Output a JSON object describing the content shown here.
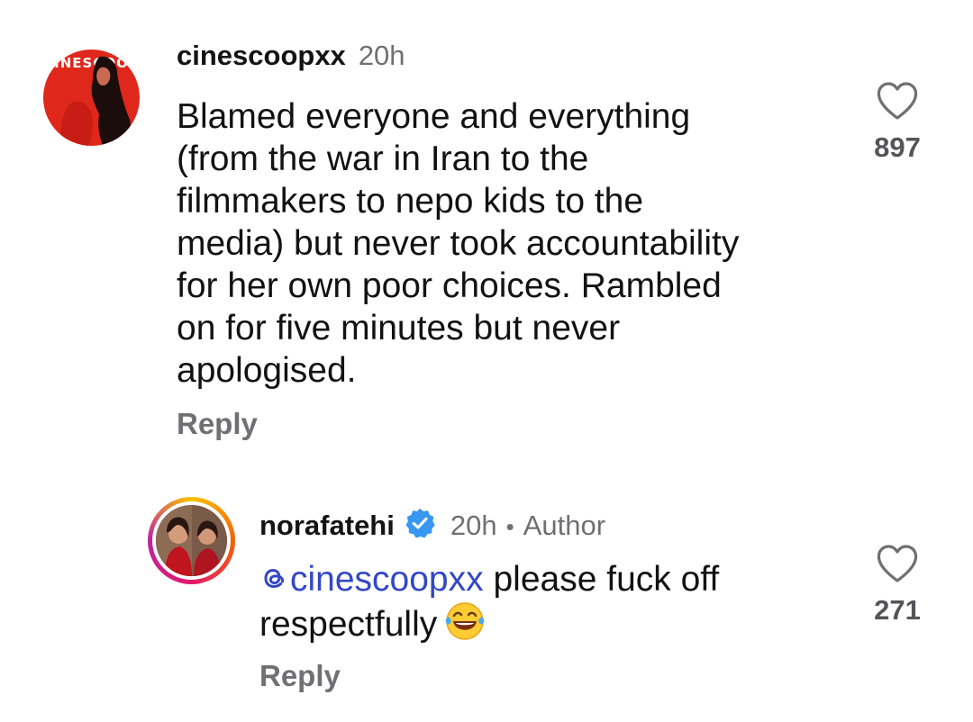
{
  "comments": [
    {
      "username": "cinescoopxx",
      "time": "20h",
      "avatar_text": "CINESCOOP",
      "body": "Blamed everyone and everything\n(from the war in Iran to the\nfilmmakers to nepo kids to the\nmedia) but never took accountability\nfor her own poor choices. Rambled\non for five minutes but never\napologised.",
      "reply_label": "Reply",
      "likes": "897"
    }
  ],
  "reply": {
    "username": "norafatehi",
    "verified": true,
    "time": "20h",
    "separator": "•",
    "author_label": "Author",
    "mention": "cinescoopxx",
    "text_line1": "please fuck off",
    "text_line2": "respectfully",
    "emoji": "face-with-tears-of-joy",
    "reply_label": "Reply",
    "likes": "271"
  },
  "colors": {
    "mention": "#3347c7",
    "verified_badge": "#3897f0",
    "muted_text": "#6f6f74"
  }
}
